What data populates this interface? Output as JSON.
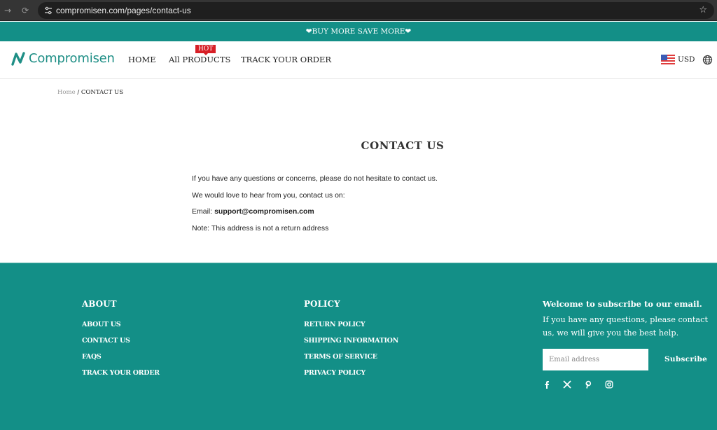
{
  "browser": {
    "back_icon": "→",
    "reload_icon": "⟳",
    "site_settings_icon": "⚙",
    "url": "compromisen.com/pages/contact-us",
    "bookmark_icon": "☆"
  },
  "announcement": {
    "text": "❤BUY MORE SAVE MORE❤"
  },
  "header": {
    "logo_text": "Compromisen",
    "nav": [
      {
        "label": "HOME"
      },
      {
        "label": "All PRODUCTS",
        "badge": "HOT"
      },
      {
        "label": "TRACK YOUR ORDER"
      }
    ],
    "currency": "USD",
    "brand_color": "#138f87",
    "badge_color": "#d71f26"
  },
  "breadcrumb": {
    "home": "Home",
    "separator": "/",
    "current": "CONTACT US"
  },
  "main": {
    "title": "CONTACT US",
    "lines": [
      "If you have any questions or concerns, please do not hesitate to contact us.",
      "We would love to hear from you, contact us on:"
    ],
    "email_label": "Email: ",
    "email_value": "support@compromisen.com",
    "note": "Note: This address is not a return address"
  },
  "footer": {
    "about": {
      "heading": "ABOUT",
      "links": [
        "ABOUT US",
        "CONTACT US",
        "FAQS",
        "TRACK YOUR ORDER"
      ]
    },
    "policy": {
      "heading": "POLICY",
      "links": [
        "RETURN POLICY",
        "SHIPPING INFORMATION",
        "TERMS OF SERVICE",
        "PRIVACY POLICY"
      ]
    },
    "subscribe": {
      "heading": "Welcome to subscribe to our email.",
      "description": "If you have any questions, please contact us, we will give you the best help.",
      "input_value": "",
      "input_placeholder": "Email address",
      "button_label": "Subscribe"
    },
    "social": [
      "facebook-icon",
      "x-icon",
      "pinterest-icon",
      "instagram-icon"
    ]
  }
}
